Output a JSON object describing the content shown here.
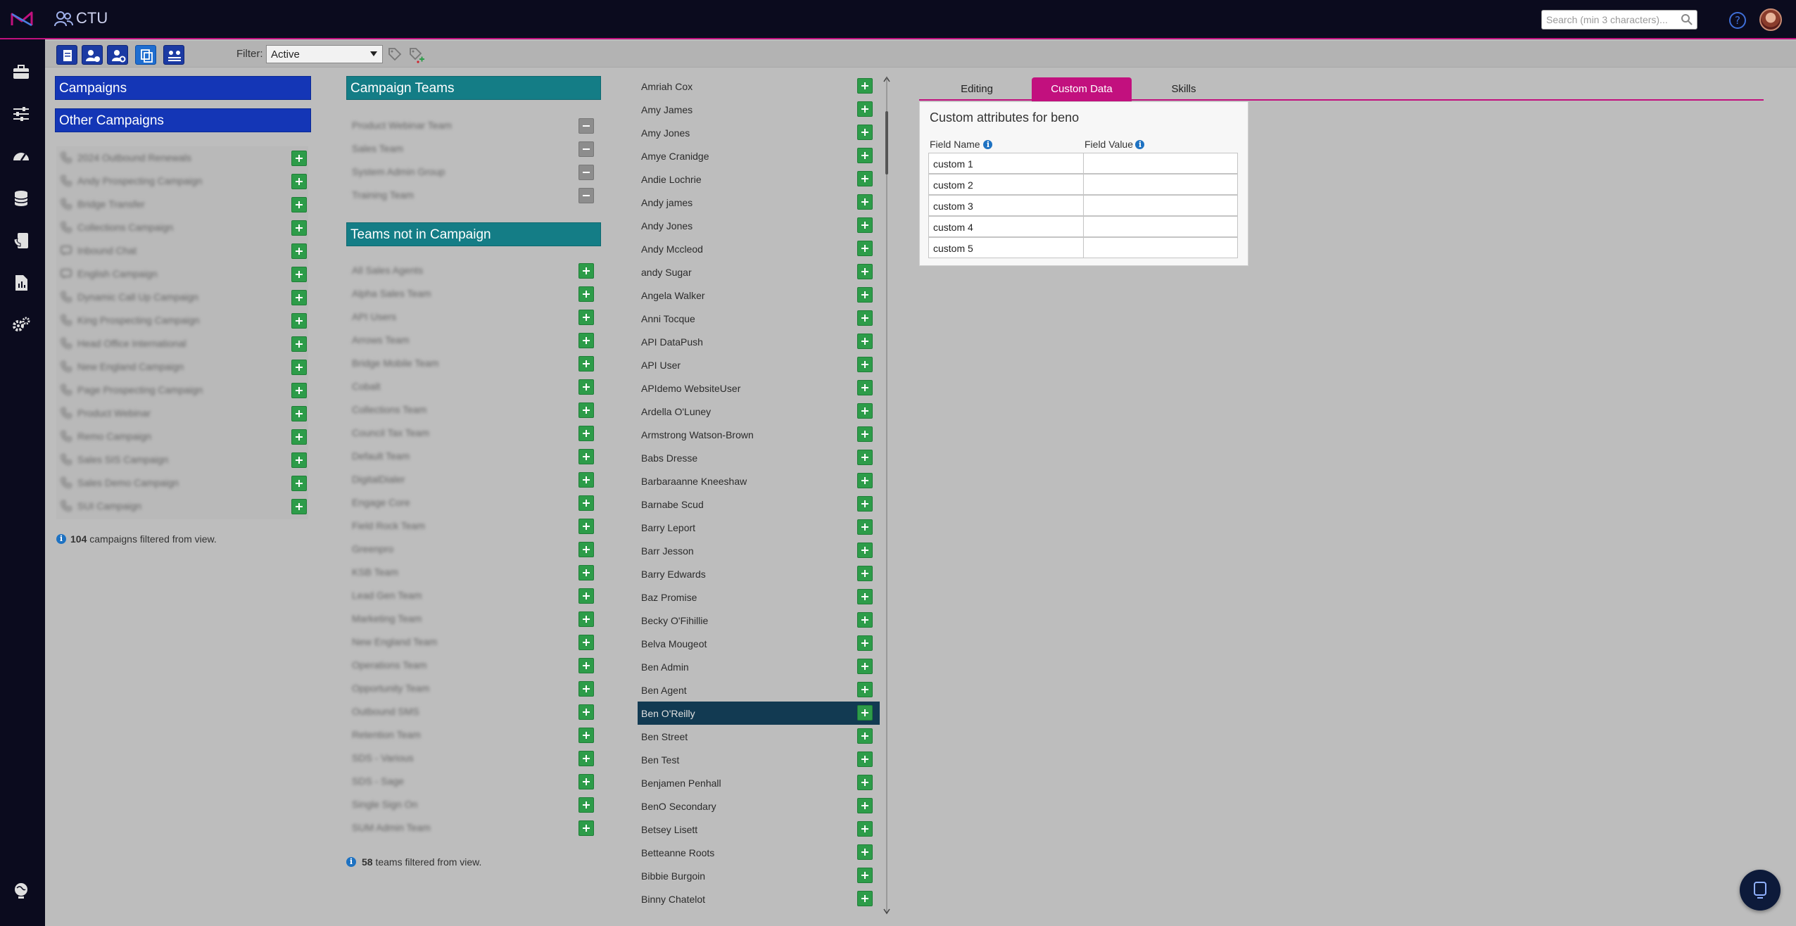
{
  "app": {
    "title": "CTU"
  },
  "header": {
    "search_placeholder": "Search (min 3 characters)..."
  },
  "toolbar": {
    "filter_label": "Filter:",
    "filter_value": "Active"
  },
  "campaigns": {
    "header": "Campaigns",
    "other_header": "Other Campaigns",
    "items": [
      {
        "label": "2024 Outbound Renewals",
        "icon": "phone-icon"
      },
      {
        "label": "Andy Prospecting Campaign",
        "icon": "phone-icon"
      },
      {
        "label": "Bridge Transfer",
        "icon": "phone-icon"
      },
      {
        "label": "Collections Campaign",
        "icon": "phone-icon"
      },
      {
        "label": "Inbound Chat",
        "icon": "chat-icon"
      },
      {
        "label": "English Campaign",
        "icon": "chat-icon"
      },
      {
        "label": "Dynamic Call Up Campaign",
        "icon": "phone-icon"
      },
      {
        "label": "King Prospecting Campaign",
        "icon": "phone-icon"
      },
      {
        "label": "Head Office International",
        "icon": "phone-icon"
      },
      {
        "label": "New England Campaign",
        "icon": "phone-icon"
      },
      {
        "label": "Page Prospecting Campaign",
        "icon": "phone-icon"
      },
      {
        "label": "Product Webinar",
        "icon": "phone-icon"
      },
      {
        "label": "Remo Campaign",
        "icon": "phone-icon"
      },
      {
        "label": "Sales SIS Campaign",
        "icon": "phone-icon"
      },
      {
        "label": "Sales Demo Campaign",
        "icon": "phone-icon"
      },
      {
        "label": "SUI Campaign",
        "icon": "phone-icon"
      }
    ],
    "filtered_count": "104",
    "filtered_text": "campaigns filtered from view."
  },
  "teams": {
    "header": "Campaign Teams",
    "in_campaign": [
      "Product Webinar Team",
      "Sales Team",
      "System Admin Group",
      "Training Team"
    ],
    "not_header": "Teams not in Campaign",
    "not_in_campaign": [
      "All Sales Agents",
      "Alpha Sales Team",
      "API Users",
      "Arrows Team",
      "Bridge Mobile Team",
      "Cobalt",
      "Collections Team",
      "Council Tax Team",
      "Default Team",
      "DigitalDialer",
      "Engage Core",
      "Field Rock Team",
      "Greenpro",
      "KSB Team",
      "Lead Gen Team",
      "Marketing Team",
      "New England Team",
      "Operations Team",
      "Opportunity Team",
      "Outbound SMS",
      "Retention Team",
      "SDS - Various",
      "SDS - Sage",
      "Single Sign On",
      "SUM Admin Team"
    ],
    "filtered_count": "58",
    "filtered_text": "teams filtered from view."
  },
  "users": {
    "items": [
      "Amriah Cox",
      "Amy James",
      "Amy Jones",
      "Amye Cranidge",
      "Andie Lochrie",
      "Andy james",
      "Andy Jones",
      "Andy Mccleod",
      "andy Sugar",
      "Angela Walker",
      "Anni Tocque",
      "API DataPush",
      "API User",
      "APIdemo WebsiteUser",
      "Ardella O'Luney",
      "Armstrong Watson-Brown",
      "Babs Dresse",
      "Barbaraanne Kneeshaw",
      "Barnabe Scud",
      "Barry Leport",
      "Barr Jesson",
      "Barry Edwards",
      "Baz Promise",
      "Becky O'Fihillie",
      "Belva Mougeot",
      "Ben Admin",
      "Ben Agent",
      "Ben O'Reilly",
      "Ben Street",
      "Ben Test",
      "Benjamen Penhall",
      "BenO Secondary",
      "Betsey Lisett",
      "Betteanne Roots",
      "Bibbie Burgoin",
      "Binny Chatelot"
    ],
    "selected": "Ben O'Reilly"
  },
  "tabs": {
    "editing": "Editing",
    "custom_data": "Custom Data",
    "skills": "Skills",
    "active": "Custom Data"
  },
  "custom_data": {
    "title": "Custom attributes for beno",
    "field_name_header": "Field Name",
    "field_value_header": "Field Value",
    "rows": [
      {
        "name": "custom 1",
        "value": ""
      },
      {
        "name": "custom 2",
        "value": ""
      },
      {
        "name": "custom 3",
        "value": ""
      },
      {
        "name": "custom 4",
        "value": ""
      },
      {
        "name": "custom 5",
        "value": ""
      }
    ]
  },
  "colors": {
    "accent": "#c2107e",
    "nav_bg": "#0b0b1e",
    "campaign_header": "#1436b6",
    "team_header": "#147d86",
    "add_button": "#2d9c49",
    "selected_row": "#123a52"
  }
}
